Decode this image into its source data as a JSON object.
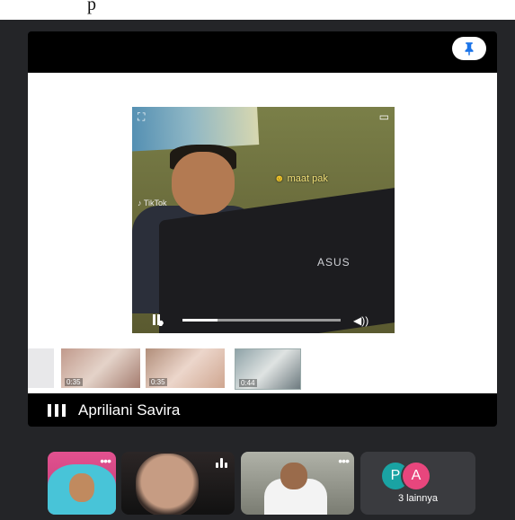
{
  "top_strip": {
    "fragment": "p"
  },
  "stage": {
    "pin_icon": "pin-icon",
    "shared_video": {
      "overlay_text": "maat pak",
      "watermark_brand": "TikTok",
      "laptop_logo": "ASUS",
      "progress_fraction": 0.22
    },
    "thumbnails": [
      {
        "label": ""
      },
      {
        "label": "0:35"
      },
      {
        "label": "0:35"
      },
      {
        "label": "0:44"
      }
    ],
    "presenter_name": "Apriliani Savira"
  },
  "participants": [
    {
      "name": "participant-1"
    },
    {
      "name": "participant-2"
    },
    {
      "name": "participant-3"
    }
  ],
  "others": {
    "avatars": [
      "P",
      "A"
    ],
    "label": "3 lainnya",
    "colors": [
      "#1aa3a3",
      "#e8467d"
    ]
  }
}
